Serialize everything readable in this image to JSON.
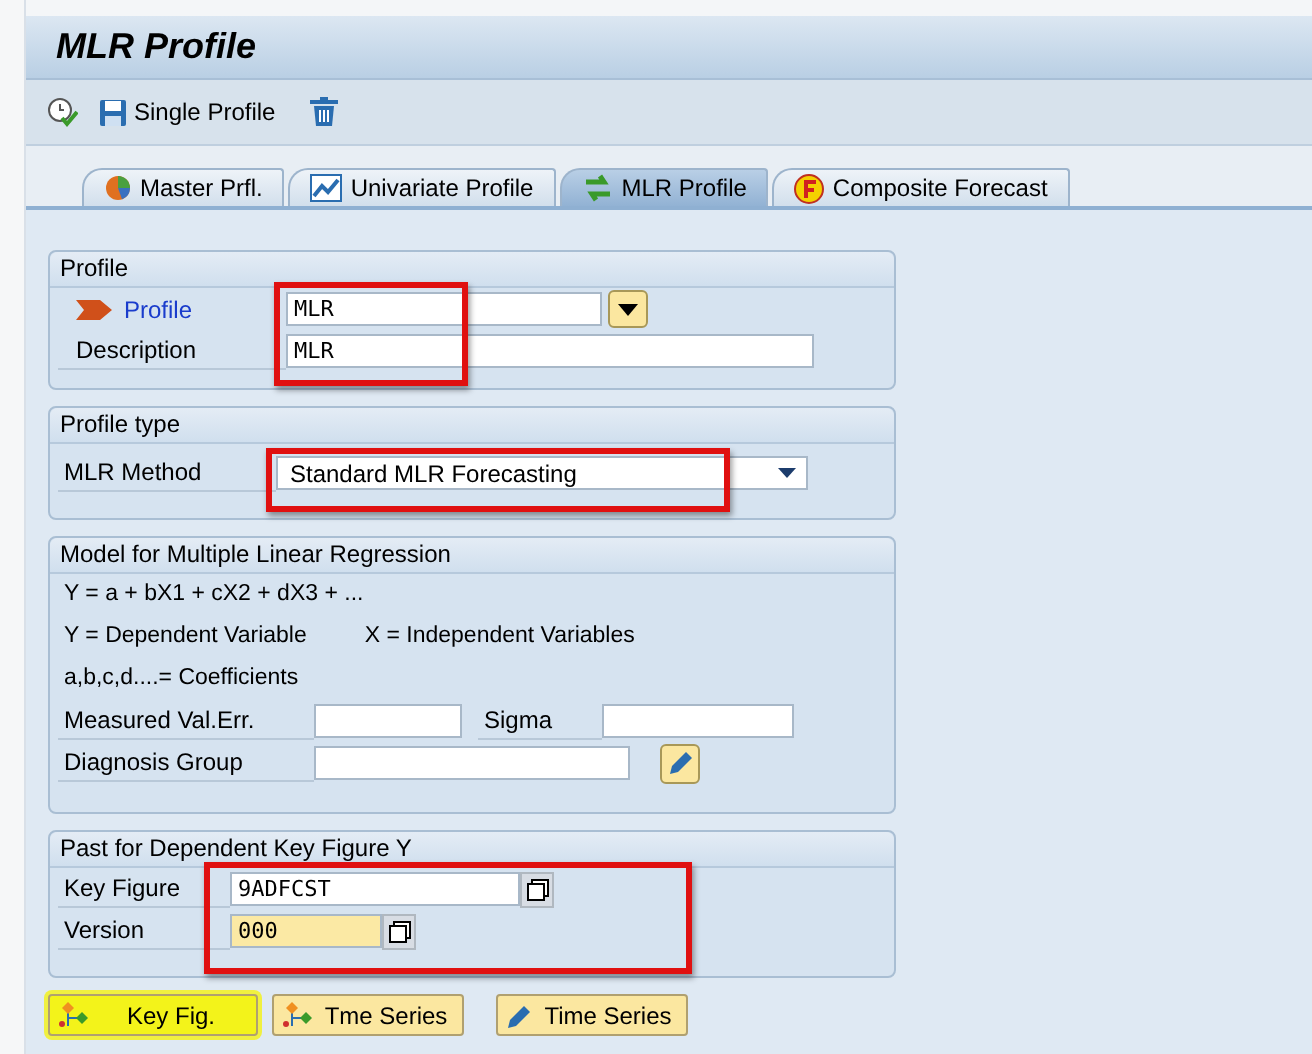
{
  "window": {
    "title": "MLR Profile"
  },
  "toolbar": [
    {
      "kind": "check"
    },
    {
      "kind": "save",
      "label": "Single Profile"
    },
    {
      "kind": "delete"
    }
  ],
  "tabs": [
    {
      "label": "Master Prfl.",
      "selected": false
    },
    {
      "label": "Univariate Profile",
      "selected": false
    },
    {
      "label": "MLR Profile",
      "selected": true
    },
    {
      "label": "Composite Forecast",
      "selected": false
    }
  ],
  "profile_group": {
    "title": "Profile",
    "profile_label": "Profile",
    "profile_value": "MLR",
    "description_label": "Description",
    "description_value": "MLR"
  },
  "profile_type_group": {
    "title": "Profile type",
    "method_label": "MLR Method",
    "method_value": "Standard MLR Forecasting"
  },
  "model_group": {
    "title": "Model for Multiple Linear Regression",
    "formula": "Y = a + bX1 + cX2 + dX3 + ...",
    "dependent": "Y = Dependent Variable",
    "independent": "X = Independent Variables",
    "coefficients": "a,b,c,d....= Coefficients",
    "measured_label": "Measured Val.Err.",
    "sigma_label": "Sigma",
    "diagnosis_label": "Diagnosis Group"
  },
  "past_group": {
    "title": "Past for Dependent Key Figure Y",
    "key_figure_label": "Key Figure",
    "key_figure_value": "9ADFCST",
    "version_label": "Version",
    "version_value": "000",
    "version_focused": true
  },
  "buttons": [
    {
      "label": "Key Fig.",
      "highlighted": true
    },
    {
      "label": "Tme Series",
      "highlighted": false
    },
    {
      "label": "Time Series",
      "highlighted": false
    }
  ]
}
